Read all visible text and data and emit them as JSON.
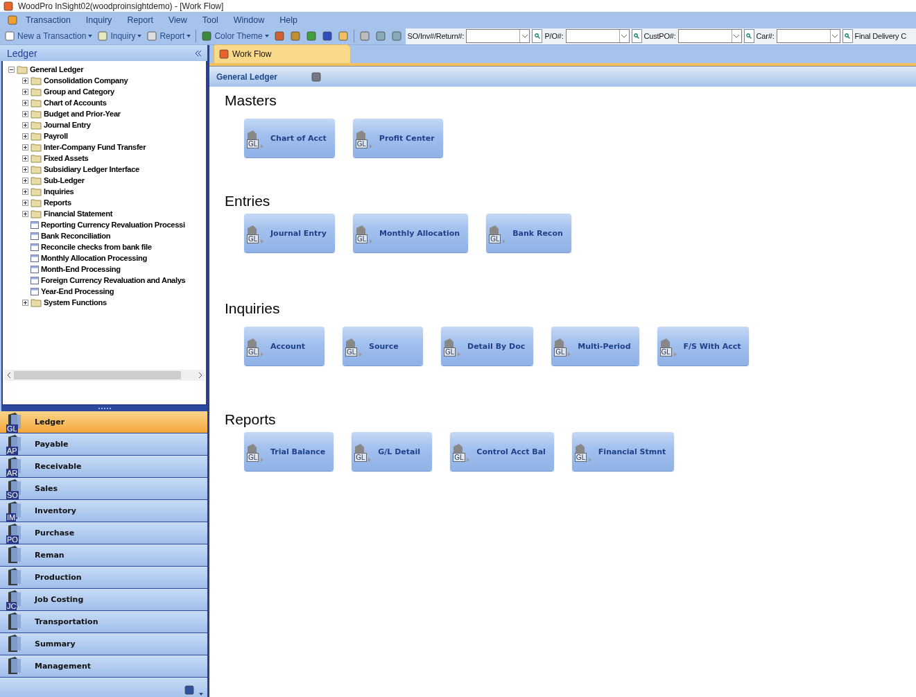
{
  "window": {
    "title": "WoodPro InSight02(woodproinsightdemo) - [Work Flow]"
  },
  "menu": [
    "Transaction",
    "Inquiry",
    "Report",
    "View",
    "Tool",
    "Window",
    "Help"
  ],
  "toolbar": {
    "buttons": [
      {
        "label": "New a Transaction",
        "kind": "dropdown"
      },
      {
        "label": "Inquiry",
        "kind": "dropdown"
      },
      {
        "label": "Report",
        "kind": "dropdown"
      },
      {
        "label": "Color Theme",
        "kind": "dropdown"
      }
    ],
    "lookups": [
      {
        "label": "SO/Inv#/Return#:"
      },
      {
        "label": "P/O#:"
      },
      {
        "label": "CustPO#:"
      },
      {
        "label": "Car#:"
      }
    ],
    "trailing_label": "Final Delivery C"
  },
  "sidebar": {
    "title": "Ledger",
    "tree": [
      {
        "label": "General Ledger",
        "kind": "folder",
        "expanded": true,
        "children": [
          {
            "label": "Consolidation Company",
            "kind": "folder",
            "expanded": false
          },
          {
            "label": "Group and Category",
            "kind": "folder",
            "expanded": false
          },
          {
            "label": "Chart of Accounts",
            "kind": "folder",
            "expanded": false
          },
          {
            "label": "Budget and Prior-Year",
            "kind": "folder",
            "expanded": false
          },
          {
            "label": "Journal Entry",
            "kind": "folder",
            "expanded": false
          },
          {
            "label": "Payroll",
            "kind": "folder",
            "expanded": false
          },
          {
            "label": "Inter-Company Fund Transfer",
            "kind": "folder",
            "expanded": false
          },
          {
            "label": "Fixed Assets",
            "kind": "folder",
            "expanded": false
          },
          {
            "label": "Subsidiary Ledger Interface",
            "kind": "folder",
            "expanded": false
          },
          {
            "label": "Sub-Ledger",
            "kind": "folder",
            "expanded": false
          },
          {
            "label": "Inquiries",
            "kind": "folder",
            "expanded": false
          },
          {
            "label": "Reports",
            "kind": "folder",
            "expanded": false
          },
          {
            "label": "Financial Statement",
            "kind": "folder",
            "expanded": false
          },
          {
            "label": "Reporting Currency Revaluation Processi",
            "kind": "form"
          },
          {
            "label": "Bank Reconciliation",
            "kind": "form"
          },
          {
            "label": "Reconcile checks from bank file",
            "kind": "form"
          },
          {
            "label": "Monthly Allocation Processing",
            "kind": "form"
          },
          {
            "label": "Month-End Processing",
            "kind": "form"
          },
          {
            "label": "Foreign Currency Revaluation and Analys",
            "kind": "form"
          },
          {
            "label": "Year-End Processing",
            "kind": "form"
          },
          {
            "label": "System Functions",
            "kind": "folder",
            "expanded": false
          }
        ]
      }
    ],
    "modules": [
      {
        "label": "Ledger",
        "badge": "GL",
        "selected": true
      },
      {
        "label": "Payable",
        "badge": "AP",
        "selected": false
      },
      {
        "label": "Receivable",
        "badge": "AR",
        "selected": false
      },
      {
        "label": "Sales",
        "badge": "SO",
        "selected": false
      },
      {
        "label": "Inventory",
        "badge": "IM",
        "selected": false
      },
      {
        "label": "Purchase",
        "badge": "PO",
        "selected": false
      },
      {
        "label": "Reman",
        "selected": false
      },
      {
        "label": "Production",
        "selected": false
      },
      {
        "label": "Job Costing",
        "badge": "JC",
        "selected": false
      },
      {
        "label": "Transportation",
        "selected": false
      },
      {
        "label": "Summary",
        "selected": false
      },
      {
        "label": "Management",
        "selected": false
      }
    ]
  },
  "tabs": [
    {
      "label": "Work Flow",
      "selected": true
    }
  ],
  "workflow": {
    "title": "General Ledger",
    "sections": [
      {
        "title": "Masters",
        "tiles": [
          {
            "label": "Chart of Acct",
            "badge": "GL"
          },
          {
            "label": "Profit Center",
            "badge": "GL"
          }
        ]
      },
      {
        "title": "Entries",
        "tiles": [
          {
            "label": "Journal Entry",
            "badge": "GL"
          },
          {
            "label": "Monthly Allocation",
            "badge": "GL"
          },
          {
            "label": "Bank Recon",
            "badge": "GL"
          }
        ]
      },
      {
        "title": "Inquiries",
        "tiles": [
          {
            "label": "Account",
            "badge": "GL"
          },
          {
            "label": "Source",
            "badge": "GL"
          },
          {
            "label": "Detail By Doc",
            "badge": "GL"
          },
          {
            "label": "Multi-Period",
            "badge": "GL"
          },
          {
            "label": "F/S With Acct",
            "badge": "GL"
          }
        ]
      },
      {
        "title": "Reports",
        "tiles": [
          {
            "label": "Trial Balance",
            "badge": "GL"
          },
          {
            "label": "G/L Detail",
            "badge": "GL"
          },
          {
            "label": "Control Acct Bal",
            "badge": "GL"
          },
          {
            "label": "Financial Stmnt",
            "badge": "GL"
          }
        ]
      }
    ]
  }
}
